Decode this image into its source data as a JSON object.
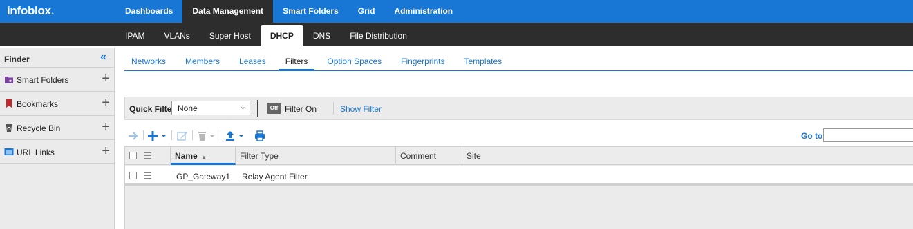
{
  "brand": {
    "logo_text": "infoblox",
    "logo_dot": "."
  },
  "top_nav": [
    "Dashboards",
    "Data Management",
    "Smart Folders",
    "Grid",
    "Administration"
  ],
  "top_nav_active": "Data Management",
  "sub_nav": [
    "IPAM",
    "VLANs",
    "Super Host",
    "DHCP",
    "DNS",
    "File Distribution"
  ],
  "sub_nav_active": "DHCP",
  "finder": {
    "title": "Finder",
    "items": [
      {
        "label": "Smart Folders",
        "icon": "smart-folder-icon",
        "color": "#7a3fa0"
      },
      {
        "label": "Bookmarks",
        "icon": "bookmark-icon",
        "color": "#c0282d"
      },
      {
        "label": "Recycle Bin",
        "icon": "recycle-bin-icon",
        "color": "#555555"
      },
      {
        "label": "URL Links",
        "icon": "url-links-icon",
        "color": "#1877d5"
      }
    ]
  },
  "tabs": [
    "Networks",
    "Members",
    "Leases",
    "Filters",
    "Option Spaces",
    "Fingerprints",
    "Templates"
  ],
  "tabs_active": "Filters",
  "filter_bar": {
    "quick_filter_label": "Quick Filter",
    "quick_filter_value": "None",
    "toggle_label": "Off",
    "filter_state": "Filter On",
    "show_filter": "Show Filter"
  },
  "toolbar": {
    "goto_label": "Go to",
    "goto_value": ""
  },
  "grid": {
    "columns": [
      "Name",
      "Filter Type",
      "Comment",
      "Site"
    ],
    "sorted_column": "Name",
    "rows": [
      {
        "name": "GP_Gateway1",
        "filter_type": "Relay Agent Filter",
        "comment": "",
        "site": ""
      }
    ]
  },
  "colors": {
    "accent": "#1877d5",
    "nav_dark": "#2d2d2d"
  }
}
